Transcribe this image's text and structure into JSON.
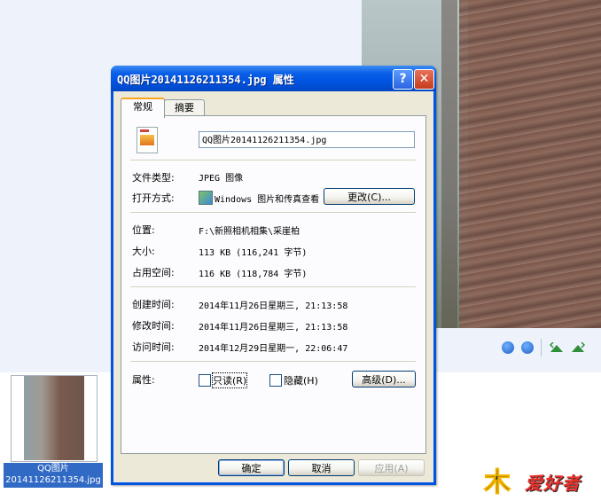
{
  "dialog": {
    "title": "QQ图片20141126211354.jpg 属性",
    "tabs": [
      "常规",
      "摘要"
    ],
    "filename": "QQ图片20141126211354.jpg",
    "file_type_label": "文件类型:",
    "file_type_value": "JPEG 图像",
    "open_with_label": "打开方式:",
    "open_with_value": "Windows 图片和传真查看器",
    "change_button": "更改(C)...",
    "location_label": "位置:",
    "location_value": "F:\\新照相机相集\\采崖柏",
    "size_label": "大小:",
    "size_value": "113 KB (116,241 字节)",
    "size_on_disk_label": "占用空间:",
    "size_on_disk_value": "116 KB (118,784 字节)",
    "created_label": "创建时间:",
    "created_value": "2014年11月26日星期三, 21:13:58",
    "modified_label": "修改时间:",
    "modified_value": "2014年11月26日星期三, 21:13:58",
    "accessed_label": "访问时间:",
    "accessed_value": "2014年12月29日星期一, 22:06:47",
    "attributes_label": "属性:",
    "readonly_label": "只读(R)",
    "hidden_label": "隐藏(H)",
    "advanced_button": "高级(D)...",
    "ok_button": "确定",
    "cancel_button": "取消",
    "apply_button": "应用(A)",
    "help_glyph": "?",
    "close_glyph": "✕"
  },
  "thumbnail": {
    "caption_line1": "QQ图片",
    "caption_line2": "20141126211354.jpg"
  },
  "logo": {
    "mark": "木",
    "text": "爱好者"
  },
  "colors": {
    "titlebar": "#0054e3",
    "dialog_face": "#ece9d8",
    "selection": "#316ac5"
  }
}
